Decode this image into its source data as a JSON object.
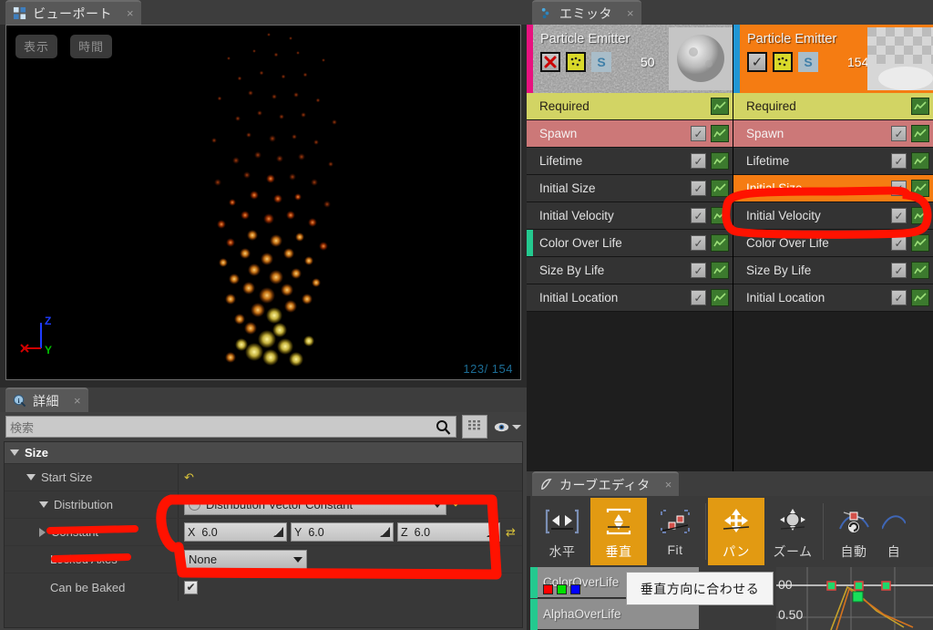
{
  "viewport": {
    "tab_label": "ビューポート",
    "tab_icon": "viewport-grid-icon",
    "close_label": "×",
    "buttons": {
      "display": "表示",
      "time": "時間"
    },
    "particle_count": "123/ 154",
    "gizmo": {
      "x": "X",
      "y": "Y",
      "z": "Z"
    }
  },
  "details": {
    "tab_label": "詳細",
    "tab_icon": "details-info-icon",
    "close_label": "×",
    "search_placeholder": "検索",
    "search_value": "",
    "category": "Size",
    "rows": [
      {
        "name": "Start Size",
        "indent": 1,
        "tri": "down",
        "value_type": "reset"
      },
      {
        "name": "Distribution",
        "indent": 2,
        "tri": "down",
        "value_type": "dropdown",
        "value": "Distribution Vector Constant"
      },
      {
        "name": "Constant",
        "indent": 2,
        "tri": "right",
        "value_type": "vector",
        "vector": [
          {
            "axis": "X",
            "value": "6.0"
          },
          {
            "axis": "Y",
            "value": "6.0"
          },
          {
            "axis": "Z",
            "value": "6.0"
          }
        ]
      },
      {
        "name": "Locked Axes",
        "indent": 2,
        "tri": "none",
        "value_type": "dropdown",
        "value": "None"
      },
      {
        "name": "Can be Baked",
        "indent": 2,
        "tri": "none",
        "value_type": "checkbox",
        "checked": true
      }
    ]
  },
  "emitter": {
    "tab_label": "エミッタ",
    "tab_icon": "emitter-icon",
    "close_label": "×",
    "columns": [
      {
        "title": "Particle Emitter",
        "accent_color": "#e8127f",
        "header_bg": "#9a9a9a",
        "enabled": false,
        "enabled_glyph": "x-mark-icon",
        "count": "50",
        "thumb": "moon-sphere-thumb",
        "modules": [
          {
            "label": "Required",
            "bg": "#d2d464",
            "fg": "#262018",
            "checkbox": false,
            "graph": true,
            "accent": ""
          },
          {
            "label": "Spawn",
            "bg": "#cc7878",
            "fg": "#f5f0f0",
            "checkbox": true,
            "graph": true,
            "accent": ""
          },
          {
            "label": "Lifetime",
            "bg": "#333333",
            "fg": "#e2e2e2",
            "checkbox": true,
            "graph": true,
            "accent": ""
          },
          {
            "label": "Initial Size",
            "bg": "#333333",
            "fg": "#e2e2e2",
            "checkbox": true,
            "graph": true,
            "accent": ""
          },
          {
            "label": "Initial Velocity",
            "bg": "#333333",
            "fg": "#e2e2e2",
            "checkbox": true,
            "graph": true,
            "accent": ""
          },
          {
            "label": "Color Over Life",
            "bg": "#333333",
            "fg": "#e2e2e2",
            "checkbox": true,
            "graph": true,
            "accent": "#24c98f"
          },
          {
            "label": "Size By Life",
            "bg": "#333333",
            "fg": "#e2e2e2",
            "checkbox": true,
            "graph": true,
            "accent": ""
          },
          {
            "label": "Initial Location",
            "bg": "#333333",
            "fg": "#e2e2e2",
            "checkbox": true,
            "graph": true,
            "accent": ""
          }
        ]
      },
      {
        "title": "Particle Emitter",
        "accent_color": "#2196d4",
        "header_bg": "#f57c12",
        "enabled": true,
        "enabled_glyph": "check-mark-icon",
        "count": "154",
        "thumb": "checker-plane-thumb",
        "modules": [
          {
            "label": "Required",
            "bg": "#d2d464",
            "fg": "#262018",
            "checkbox": false,
            "graph": true,
            "accent": "",
            "selected": false
          },
          {
            "label": "Spawn",
            "bg": "#cc7878",
            "fg": "#f5f0f0",
            "checkbox": true,
            "graph": true,
            "accent": "",
            "selected": false
          },
          {
            "label": "Lifetime",
            "bg": "#333333",
            "fg": "#e2e2e2",
            "checkbox": true,
            "graph": true,
            "accent": "",
            "selected": false
          },
          {
            "label": "Initial Size",
            "bg": "#f57c12",
            "fg": "#ffffff",
            "checkbox": true,
            "graph": true,
            "accent": "",
            "selected": true
          },
          {
            "label": "Initial Velocity",
            "bg": "#333333",
            "fg": "#e2e2e2",
            "checkbox": true,
            "graph": true,
            "accent": "",
            "selected": false
          },
          {
            "label": "Color Over Life",
            "bg": "#333333",
            "fg": "#e2e2e2",
            "checkbox": true,
            "graph": true,
            "accent": "",
            "selected": false
          },
          {
            "label": "Size By Life",
            "bg": "#333333",
            "fg": "#e2e2e2",
            "checkbox": true,
            "graph": true,
            "accent": "",
            "selected": false
          },
          {
            "label": "Initial Location",
            "bg": "#333333",
            "fg": "#e2e2e2",
            "checkbox": true,
            "graph": true,
            "accent": "",
            "selected": false
          }
        ]
      }
    ]
  },
  "curve_editor": {
    "tab_label": "カーブエディタ",
    "tab_icon": "curve-icon",
    "close_label": "×",
    "tools": [
      {
        "label": "水平",
        "icon": "fit-horizontal-icon",
        "active": false
      },
      {
        "label": "垂直",
        "icon": "fit-vertical-icon",
        "active": true
      },
      {
        "label": "Fit",
        "icon": "fit-selection-icon",
        "active": false
      },
      {
        "label": "パン",
        "icon": "pan-icon",
        "active": true
      },
      {
        "label": "ズーム",
        "icon": "zoom-icon",
        "active": false
      },
      {
        "label": "自動",
        "icon": "auto-tangent-icon",
        "active": false
      },
      {
        "label": "自",
        "icon": "auto-clamp-icon",
        "active": false
      }
    ],
    "tracks": [
      {
        "name": "ColorOverLife",
        "accent": "#24c98f",
        "swatches": [
          "#ff0000",
          "#00e000",
          "#0000ff"
        ]
      },
      {
        "name": "AlphaOverLife",
        "accent": "#24c98f",
        "swatches": []
      }
    ],
    "axis_labels": [
      "00",
      "0.50"
    ],
    "tooltip": "垂直方向に合わせる"
  },
  "annotations": {
    "color": "#ff1200",
    "marks": [
      "ellipse-around-initial-size-module",
      "rect-around-distribution-and-constant",
      "underline-distribution",
      "underline-constant"
    ]
  }
}
